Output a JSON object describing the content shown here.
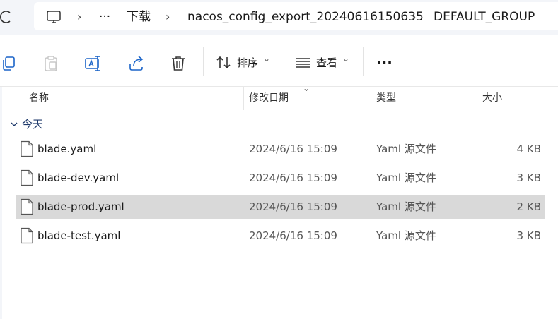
{
  "breadcrumb": {
    "items": [
      "下载",
      "nacos_config_export_20240616150635",
      "DEFAULT_GROUP"
    ],
    "more": "···",
    "separator": "›"
  },
  "toolbar": {
    "sort_label": "排序",
    "view_label": "查看",
    "more_label": "···",
    "dropdown_caret": "⌄"
  },
  "columns": {
    "name": "名称",
    "date": "修改日期",
    "type": "类型",
    "size": "大小"
  },
  "group": {
    "label": "今天"
  },
  "files": [
    {
      "name": "blade.yaml",
      "date": "2024/6/16 15:09",
      "type": "Yaml 源文件",
      "size": "4 KB"
    },
    {
      "name": "blade-dev.yaml",
      "date": "2024/6/16 15:09",
      "type": "Yaml 源文件",
      "size": "3 KB"
    },
    {
      "name": "blade-prod.yaml",
      "date": "2024/6/16 15:09",
      "type": "Yaml 源文件",
      "size": "2 KB"
    },
    {
      "name": "blade-test.yaml",
      "date": "2024/6/16 15:09",
      "type": "Yaml 源文件",
      "size": "3 KB"
    }
  ],
  "selected_file": "blade-prod.yaml",
  "colors": {
    "selection": "#d9d9d9",
    "group_label": "#1f3a6b",
    "address_strip": "#f3f5f9"
  }
}
